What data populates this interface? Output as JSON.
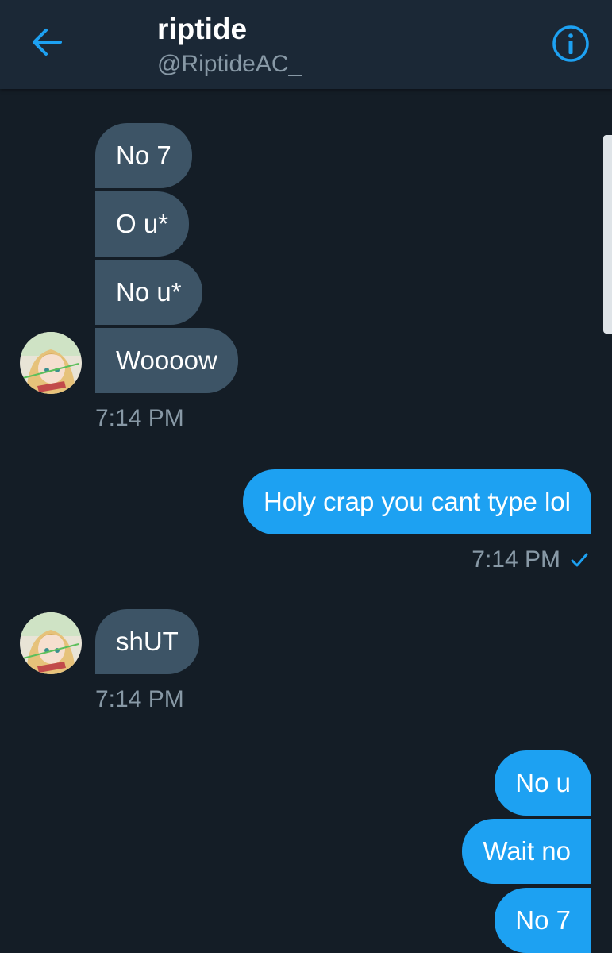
{
  "header": {
    "back_icon": "arrow-left-icon",
    "name": "riptide",
    "handle": "@RiptideAC_",
    "info_icon": "info-circle-icon"
  },
  "colors": {
    "background": "#141d26",
    "header": "#1b2836",
    "incoming_bubble": "#3d5466",
    "outgoing_bubble": "#1da1f2",
    "accent": "#1da1f2",
    "muted_text": "#8899a6"
  },
  "messages": {
    "group1": [
      "No 7",
      "O u*",
      "No u*",
      "Woooow"
    ],
    "group1_time": "7:14 PM",
    "group2": [
      "Holy crap you cant type lol"
    ],
    "group2_time": "7:14 PM",
    "group2_read_icon": "checkmark-icon",
    "group3": [
      "shUT"
    ],
    "group3_time": "7:14 PM",
    "group4": [
      "No u",
      "Wait no",
      "No 7"
    ]
  }
}
